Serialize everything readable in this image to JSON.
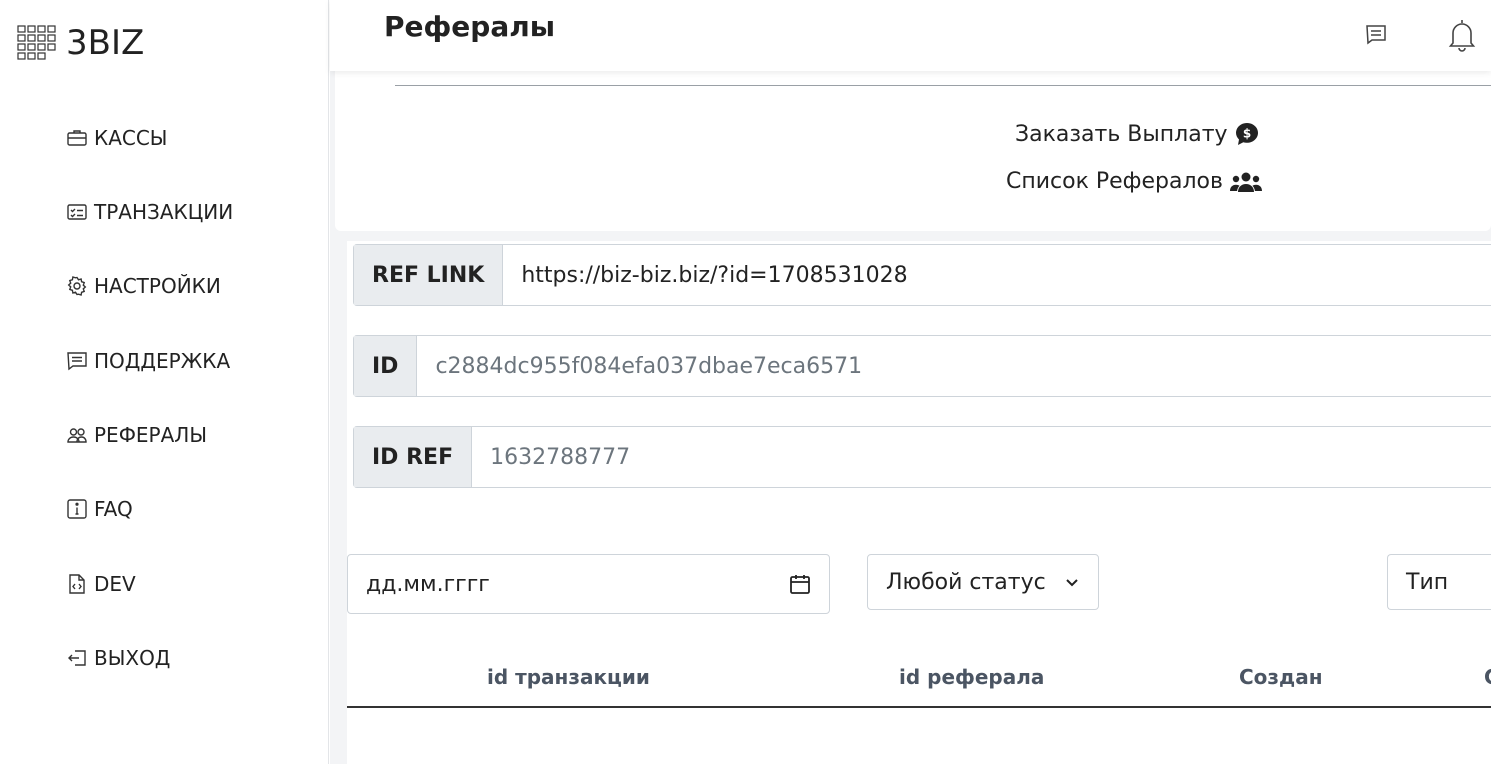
{
  "app": {
    "logo_text": "3BIZ"
  },
  "sidebar": {
    "items": [
      {
        "label": "КАССЫ",
        "icon": "briefcase-icon"
      },
      {
        "label": "ТРАНЗАКЦИИ",
        "icon": "checklist-icon"
      },
      {
        "label": "НАСТРОЙКИ",
        "icon": "gear-icon"
      },
      {
        "label": "ПОДДЕРЖКА",
        "icon": "message-icon"
      },
      {
        "label": "РЕФЕРАЛЫ",
        "icon": "people-icon"
      },
      {
        "label": "FAQ",
        "icon": "info-icon"
      },
      {
        "label": "DEV",
        "icon": "code-file-icon"
      },
      {
        "label": "ВЫХОД",
        "icon": "logout-icon"
      }
    ]
  },
  "header": {
    "title": "Рефералы",
    "icons": [
      "chat-icon",
      "bell-icon"
    ]
  },
  "actions": {
    "payout_label": "Заказать Выплату",
    "payout_icon": "dollar-chat-icon",
    "referrals_list_label": "Список Рефералов",
    "referrals_list_icon": "users-icon"
  },
  "fields": {
    "ref_link": {
      "label": "REF LINK",
      "value": "https://biz-biz.biz/?id=1708531028"
    },
    "id": {
      "label": "ID",
      "value": "c2884dc955f084efa037dbae7eca6571"
    },
    "id_ref": {
      "label": "ID REF",
      "value": "1632788777"
    }
  },
  "filters": {
    "date_placeholder": "дд.мм.гггг",
    "status_selected": "Любой статус",
    "type_selected": "Тип"
  },
  "table": {
    "headers": [
      "id транзакции",
      "id реферала",
      "Создан",
      "С"
    ]
  },
  "colors": {
    "accent": "#212529",
    "muted_text": "#6c757d",
    "label_bg": "#e9ecef",
    "page_bg": "#f3f4f6"
  }
}
